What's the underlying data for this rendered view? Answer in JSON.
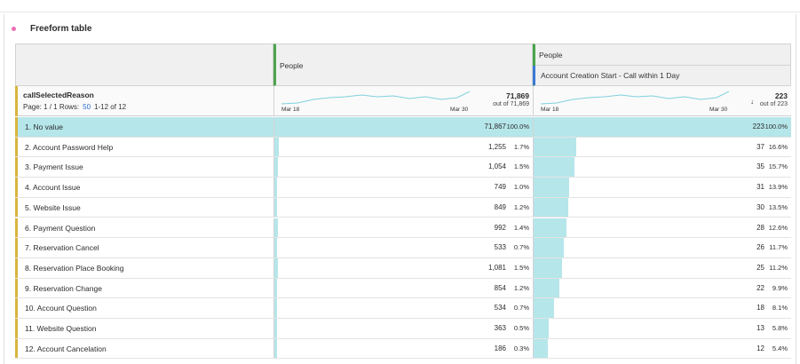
{
  "panel": {
    "title": "Freeform table"
  },
  "columns": {
    "m1_label": "People",
    "m2_label": "People",
    "m2_segment": "Account Creation Start - Call within 1 Day"
  },
  "dimension": {
    "name": "callSelectedReason"
  },
  "pager": {
    "page_label": "Page: 1 / 1 Rows:",
    "rows_per_page": "50",
    "range": "1-12 of 12"
  },
  "summary": {
    "m1": {
      "total": "71,869",
      "sub": "out of 71,869",
      "start": "Mar 18",
      "end": "Mar 30"
    },
    "m2": {
      "total": "223",
      "sub": "out of 223",
      "start": "Mar 18",
      "end": "Mar 30"
    }
  },
  "colors": {
    "bar": "#b5e6ea",
    "dim_accent": "#d9b43c",
    "metric_accent": "#4ca54c",
    "segment_accent": "#3a7bd5"
  },
  "rows": [
    {
      "label": "1. No value",
      "m1": "71,867",
      "m1_pct": "100.0%",
      "m1_frac": 1.0,
      "m2": "223",
      "m2_pct": "100.0%",
      "m2_frac": 1.0
    },
    {
      "label": "2. Account Password Help",
      "m1": "1,255",
      "m1_pct": "1.7%",
      "m1_frac": 0.017,
      "m2": "37",
      "m2_pct": "16.6%",
      "m2_frac": 0.166
    },
    {
      "label": "3. Payment Issue",
      "m1": "1,054",
      "m1_pct": "1.5%",
      "m1_frac": 0.015,
      "m2": "35",
      "m2_pct": "15.7%",
      "m2_frac": 0.157
    },
    {
      "label": "4. Account Issue",
      "m1": "749",
      "m1_pct": "1.0%",
      "m1_frac": 0.01,
      "m2": "31",
      "m2_pct": "13.9%",
      "m2_frac": 0.139
    },
    {
      "label": "5. Website Issue",
      "m1": "849",
      "m1_pct": "1.2%",
      "m1_frac": 0.012,
      "m2": "30",
      "m2_pct": "13.5%",
      "m2_frac": 0.135
    },
    {
      "label": "6. Payment Question",
      "m1": "992",
      "m1_pct": "1.4%",
      "m1_frac": 0.014,
      "m2": "28",
      "m2_pct": "12.6%",
      "m2_frac": 0.126
    },
    {
      "label": "7. Reservation Cancel",
      "m1": "533",
      "m1_pct": "0.7%",
      "m1_frac": 0.007,
      "m2": "26",
      "m2_pct": "11.7%",
      "m2_frac": 0.117
    },
    {
      "label": "8. Reservation Place Booking",
      "m1": "1,081",
      "m1_pct": "1.5%",
      "m1_frac": 0.015,
      "m2": "25",
      "m2_pct": "11.2%",
      "m2_frac": 0.112
    },
    {
      "label": "9. Reservation Change",
      "m1": "854",
      "m1_pct": "1.2%",
      "m1_frac": 0.012,
      "m2": "22",
      "m2_pct": "9.9%",
      "m2_frac": 0.099
    },
    {
      "label": "10. Account Question",
      "m1": "534",
      "m1_pct": "0.7%",
      "m1_frac": 0.007,
      "m2": "18",
      "m2_pct": "8.1%",
      "m2_frac": 0.081
    },
    {
      "label": "11. Website Question",
      "m1": "363",
      "m1_pct": "0.5%",
      "m1_frac": 0.005,
      "m2": "13",
      "m2_pct": "5.8%",
      "m2_frac": 0.058
    },
    {
      "label": "12. Account Cancelation",
      "m1": "186",
      "m1_pct": "0.3%",
      "m1_frac": 0.003,
      "m2": "12",
      "m2_pct": "5.4%",
      "m2_frac": 0.054
    }
  ]
}
